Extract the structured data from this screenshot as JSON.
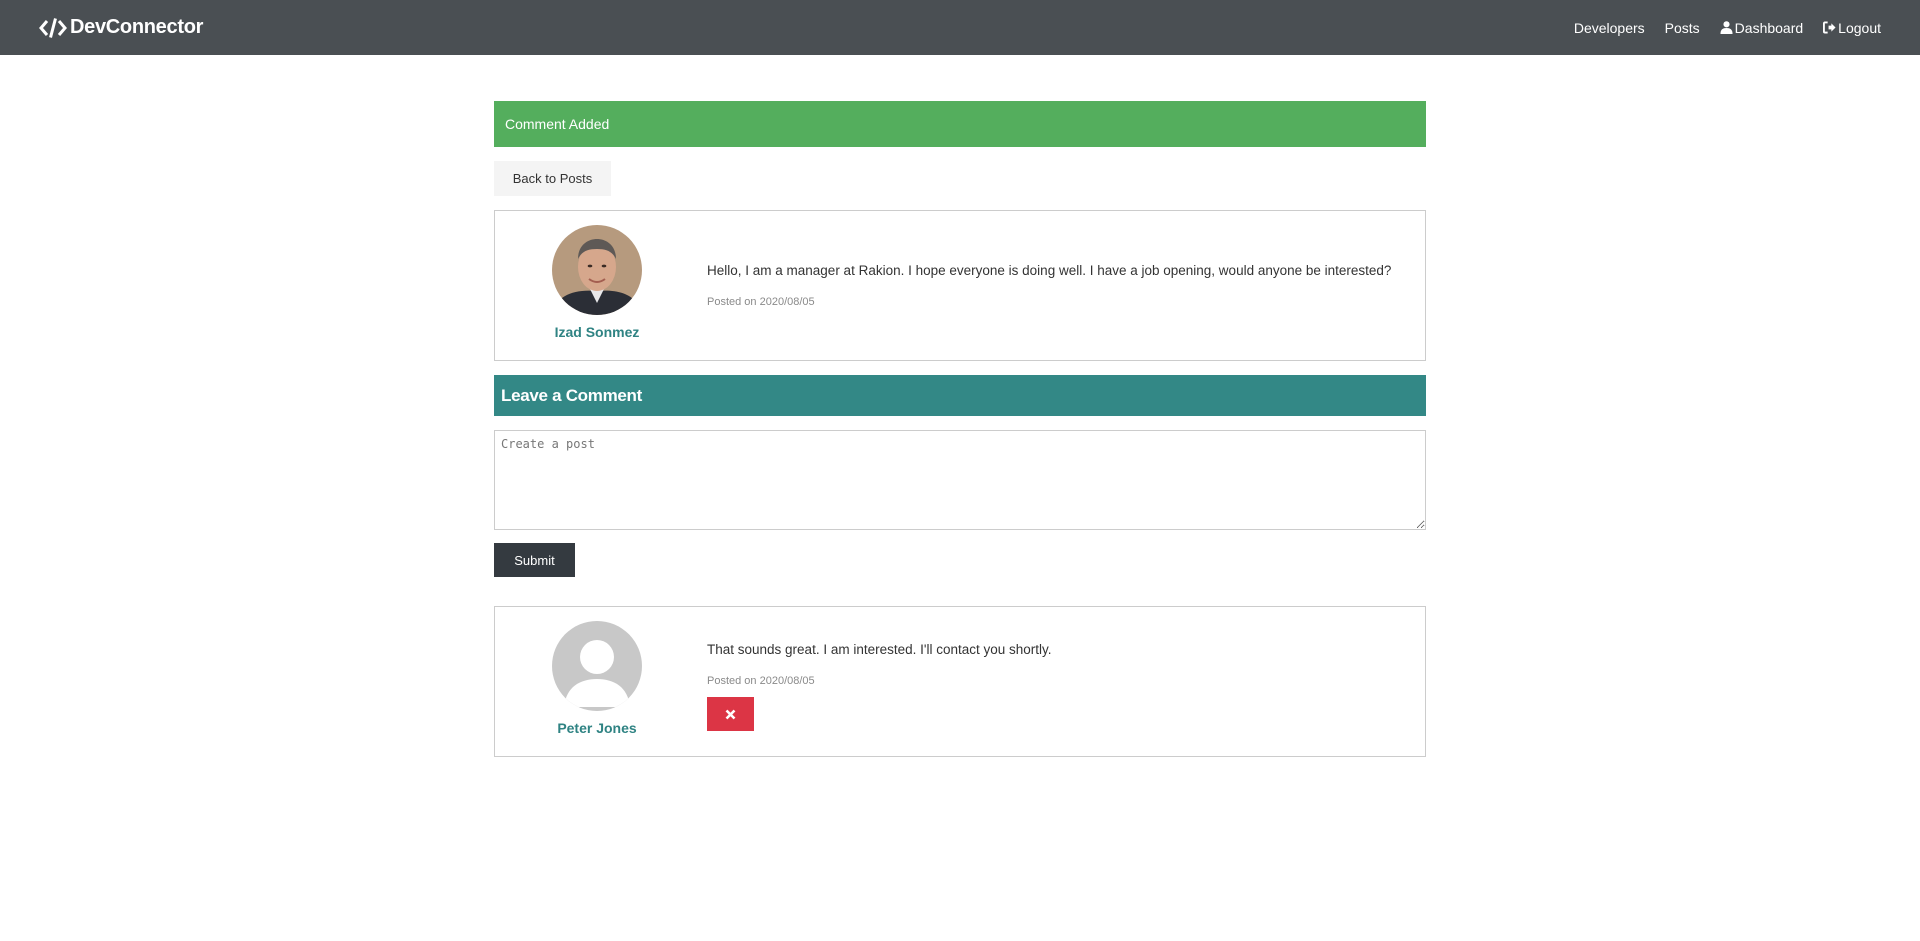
{
  "navbar": {
    "brand": "DevConnector",
    "links": [
      {
        "label": "Developers"
      },
      {
        "label": "Posts"
      },
      {
        "label": "Dashboard"
      },
      {
        "label": "Logout"
      }
    ]
  },
  "alert": {
    "text": "Comment Added"
  },
  "back_button": {
    "label": "Back to Posts"
  },
  "post": {
    "author": "Izad Sonmez",
    "text": "Hello, I am a manager at Rakion. I hope everyone is doing well. I have a job opening, would anyone be interested?",
    "date": "Posted on 2020/08/05"
  },
  "comment_form": {
    "header": "Leave a Comment",
    "placeholder": "Create a post",
    "submit_label": "Submit"
  },
  "comments": [
    {
      "author": "Peter Jones",
      "text": "That sounds great. I am interested. I'll contact you shortly.",
      "date": "Posted on 2020/08/05"
    }
  ],
  "colors": {
    "navbar": "#4a4f53",
    "alert_success": "#54ae5d",
    "primary": "#338886",
    "danger": "#dc3545",
    "dark": "#343a40"
  },
  "icons": {
    "brand": "code-icon",
    "dashboard": "user-icon",
    "logout": "sign-out-icon",
    "delete": "times-icon"
  }
}
